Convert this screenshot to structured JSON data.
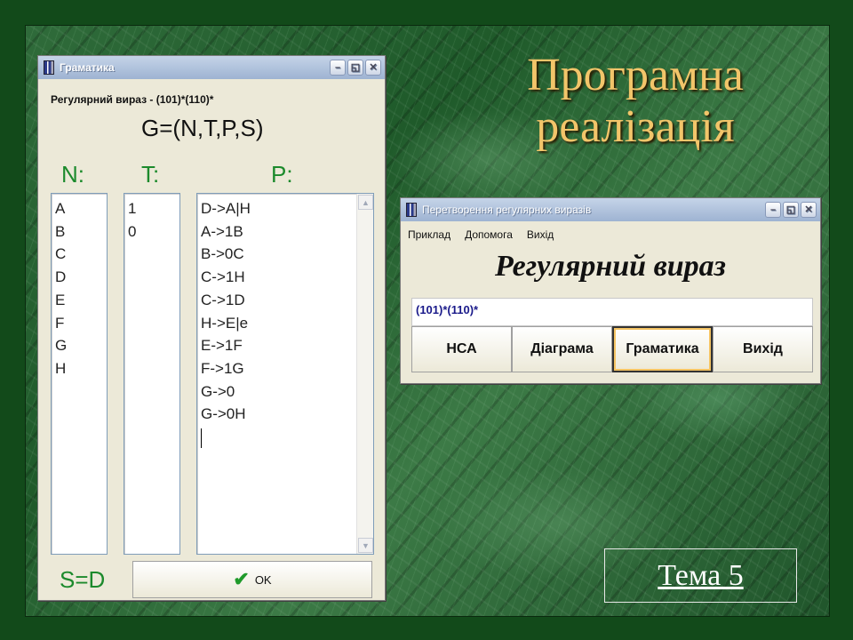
{
  "slide": {
    "title_line1": "Програмна",
    "title_line2": "реалізація",
    "topic": "Тема 5"
  },
  "grammar_window": {
    "title": "Граматика",
    "regex_caption": "Регулярний вираз - (101)*(110)*",
    "formula": "G=(N,T,P,S)",
    "label_n": "N:",
    "label_t": "T:",
    "label_p": "P:",
    "n_items": [
      "A",
      "B",
      "C",
      "D",
      "E",
      "F",
      "G",
      "H"
    ],
    "t_items": [
      "1",
      "0"
    ],
    "p_items": [
      "D->A|H",
      "A->1B",
      "B->0C",
      "C->1H",
      "C->1D",
      "H->E|e",
      "E->1F",
      "F->1G",
      "G->0",
      "G->0H"
    ],
    "start_symbol": "S=D",
    "ok_label": "OK"
  },
  "converter_window": {
    "title": "Перетворення регулярних виразів",
    "menu": [
      "Приклад",
      "Допомога",
      "Вихід"
    ],
    "heading": "Регулярний вираз",
    "input_value": "(101)*(110)*",
    "buttons": [
      "НСА",
      "Діаграма",
      "Граматика",
      "Вихід"
    ]
  },
  "colors": {
    "title_gold": "#f2c56a",
    "label_green": "#1c8a2c",
    "input_text_navy": "#1a1a8a"
  }
}
